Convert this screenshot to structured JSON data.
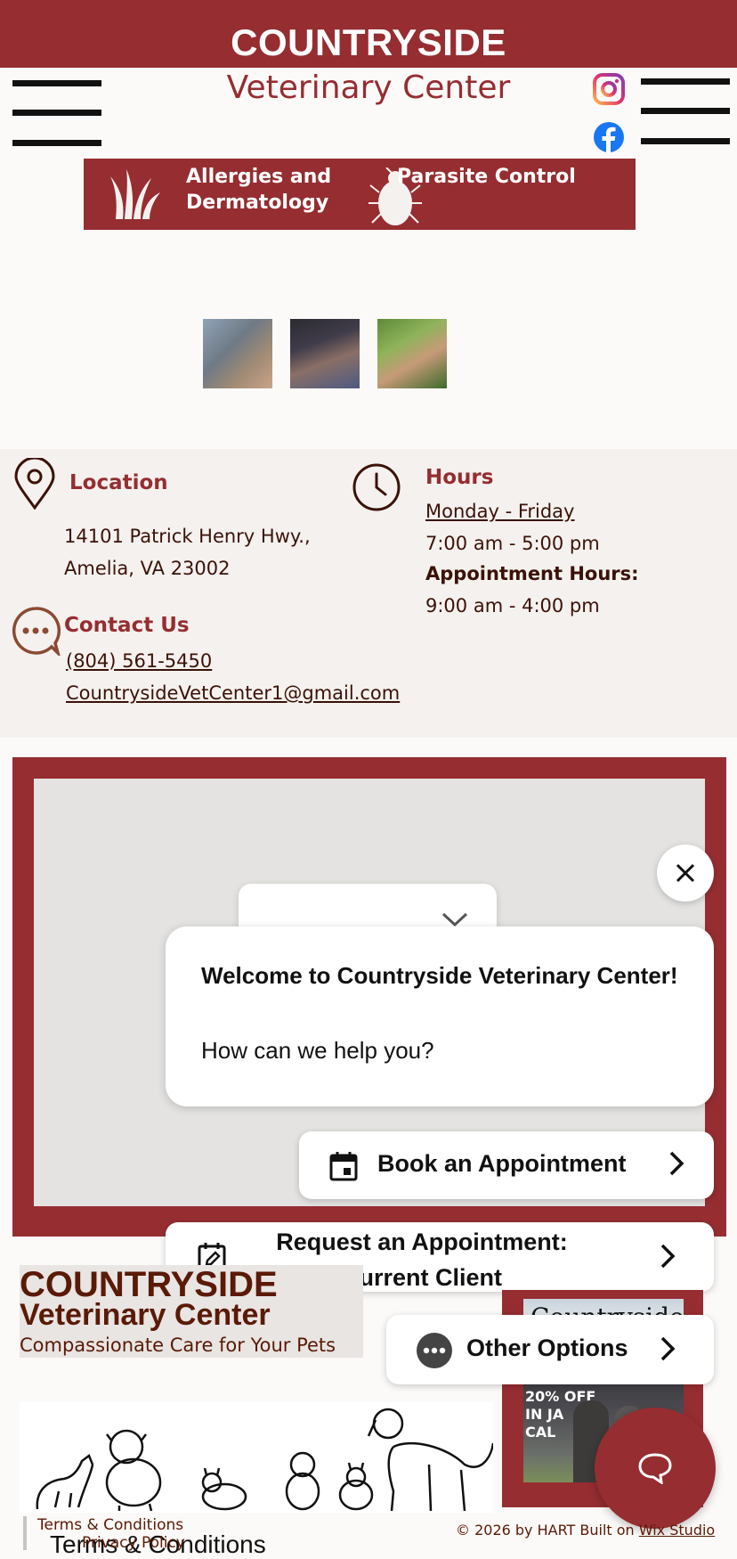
{
  "header": {
    "title": "COUNTRYSIDE",
    "subtitle": "Veterinary Center"
  },
  "social": [
    {
      "name": "instagram-icon"
    },
    {
      "name": "facebook-icon"
    }
  ],
  "services": [
    {
      "label_line1": "Allergies and",
      "label_line2": "Dermatology",
      "icon": "grass-icon"
    },
    {
      "label": "Parasite Control",
      "icon": "bug-icon"
    }
  ],
  "info": {
    "location": {
      "heading": "Location",
      "address_line1": "14101 Patrick Henry Hwy.,",
      "address_line2": "Amelia, VA 23002"
    },
    "hours": {
      "heading": "Hours",
      "days": "Monday - Friday",
      "time": "7:00 am - 5:00 pm",
      "appt_heading": "Appointment Hours:",
      "appt_time": "9:00 am - 4:00 pm"
    },
    "contact": {
      "heading": "Contact Us",
      "phone": "(804) 561-5450",
      "email": "CountrysideVetCenter1@gmail.com"
    }
  },
  "chat": {
    "welcome": "Welcome to Countryside Veterinary Center!",
    "prompt": "How can we help you?",
    "options": [
      {
        "label": "Book an Appointment",
        "icon": "calendar-icon"
      },
      {
        "label_line1": "Request an Appointment:",
        "label_line2": "Current Client",
        "icon": "calendar-edit-icon"
      },
      {
        "label": "Other Options",
        "icon": "more-icon"
      }
    ]
  },
  "footer": {
    "title_line1": "COUNTRYSIDE",
    "title_line2": "Veterinary Center",
    "tagline": "Compassionate Care for Your Pets",
    "terms": "Terms & Conditions",
    "privacy": "Privacy Policy",
    "terms_large": "Terms & Conditions",
    "copyright_prefix": "© 2026 by HART Built on ",
    "copyright_link": "Wix Studio",
    "sign_text_1": "Countryside",
    "sign_text_2": "20% OFF",
    "sign_text_3": "IN JA",
    "sign_text_4": "CAL"
  },
  "colors": {
    "brand_red": "#962d31",
    "brown": "#3b1208"
  }
}
